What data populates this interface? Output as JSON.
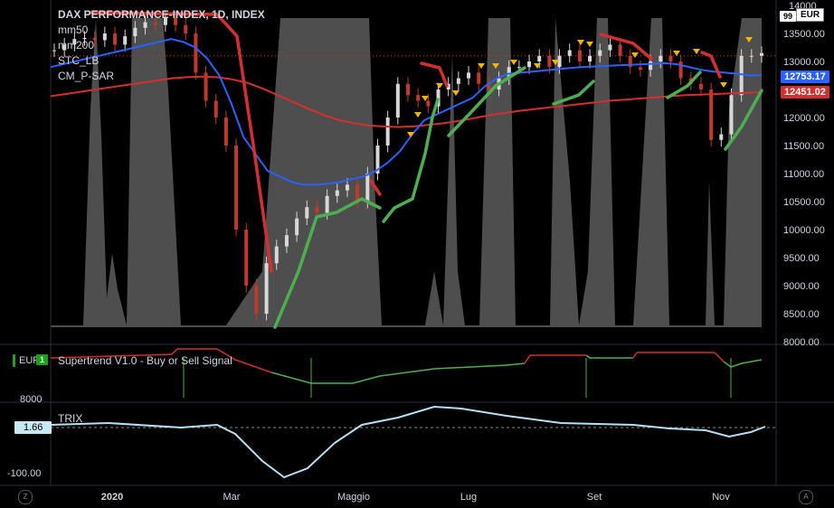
{
  "legend": {
    "title": "DAX PERFORMANCE-INDEX, 1D, INDEX",
    "lines": [
      "mm50",
      "mm200",
      "STC_LB",
      "CM_P-SAR"
    ]
  },
  "currency": "EUR",
  "top_badge": "99",
  "price_labels": {
    "blue": "12753.17",
    "red": "12451.02",
    "blue_value": 12753.17,
    "red_value": 12451.02,
    "blue_color": "#2962ff",
    "red_color": "#d32f2f"
  },
  "panes": {
    "supertrend": {
      "label": "Supertrend V1.0 - Buy or Sell Signal",
      "badge": "EUR",
      "badge_num": "1",
      "axis_label": "8000"
    },
    "trix": {
      "label": "TRIX",
      "value_badge": "1.66",
      "axis_label": "-100.00"
    }
  },
  "time_axis": {
    "labels": [
      "2020",
      "Mar",
      "Maggio",
      "Lug",
      "Set",
      "Nov"
    ]
  },
  "corner": {
    "left": "Z",
    "right": "A"
  },
  "chart_data": {
    "type": "line",
    "title": "DAX PERFORMANCE-INDEX, 1D, INDEX",
    "ylim": [
      8000,
      14000
    ],
    "y_ticks": [
      13500,
      13000,
      12500,
      12000,
      11500,
      11000,
      10500,
      10000,
      9500,
      9000,
      8500,
      8000
    ],
    "y_tick_labels": [
      "13500.00",
      "13000.00",
      "12500.00",
      "12000.00",
      "11500.00",
      "11000.00",
      "10500.00",
      "10000.00",
      "9500.00",
      "9000.00",
      "8500.00",
      "8000.00"
    ],
    "y_top_label": "14000",
    "x_labels": [
      "2020",
      "Mar",
      "Maggio",
      "Lug",
      "Set",
      "Nov"
    ],
    "reference_line": 13100,
    "series": [
      {
        "name": "price",
        "color": "#b0b0b0",
        "values": [
          13200,
          13300,
          13400,
          13420,
          13380,
          13500,
          13300,
          13450,
          13600,
          13700,
          13650,
          13780,
          13650,
          13500,
          12800,
          12300,
          12000,
          11500,
          10000,
          9000,
          8500,
          9400,
          9700,
          9900,
          10200,
          10400,
          10300,
          10600,
          10700,
          10800,
          10500,
          11000,
          11500,
          12000,
          12600,
          12400,
          12300,
          12200,
          12500,
          12600,
          12700,
          12800,
          12600,
          12500,
          12700,
          12900,
          12900,
          13000,
          13100,
          12900,
          13100,
          13200,
          13000,
          13100,
          13200,
          13300,
          13100,
          12900,
          12850,
          13000,
          13100,
          13000,
          12700,
          12600,
          12500,
          11600,
          11700,
          12400,
          13100,
          13100,
          13150
        ]
      },
      {
        "name": "mm50",
        "color": "#2962ff",
        "values": [
          12900,
          12950,
          13000,
          13050,
          13100,
          13150,
          13200,
          13250,
          13300,
          13350,
          13400,
          13350,
          13250,
          13050,
          12750,
          12250,
          11650,
          11350,
          11050,
          10950,
          10850,
          10800,
          10800,
          10820,
          10850,
          10900,
          10950,
          11050,
          11200,
          11400,
          11700,
          11950,
          12050,
          12150,
          12250,
          12350,
          12550,
          12700,
          12780,
          12800,
          12820,
          12840,
          12860,
          12880,
          12900,
          12910,
          12920,
          12930,
          12940,
          12950,
          12960,
          12970,
          12950,
          12900,
          12850,
          12820,
          12800,
          12780,
          12750,
          12753
        ]
      },
      {
        "name": "mm200",
        "color": "#d32f2f",
        "values": [
          12380,
          12420,
          12460,
          12500,
          12540,
          12580,
          12620,
          12660,
          12700,
          12720,
          12730,
          12720,
          12680,
          12620,
          12520,
          12400,
          12280,
          12160,
          12050,
          11960,
          11900,
          11860,
          11840,
          11830,
          11840,
          11870,
          11900,
          11940,
          11990,
          12040,
          12080,
          12120,
          12150,
          12180,
          12210,
          12240,
          12270,
          12300,
          12320,
          12340,
          12360,
          12380,
          12400,
          12410,
          12420,
          12430,
          12440,
          12451
        ]
      }
    ],
    "supertrend": {
      "name": "Supertrend V1.0 - Buy or Sell Signal",
      "range": [
        8000,
        14000
      ]
    },
    "trix": {
      "name": "TRIX",
      "current": 1.66,
      "range": [
        -100,
        50
      ]
    }
  }
}
